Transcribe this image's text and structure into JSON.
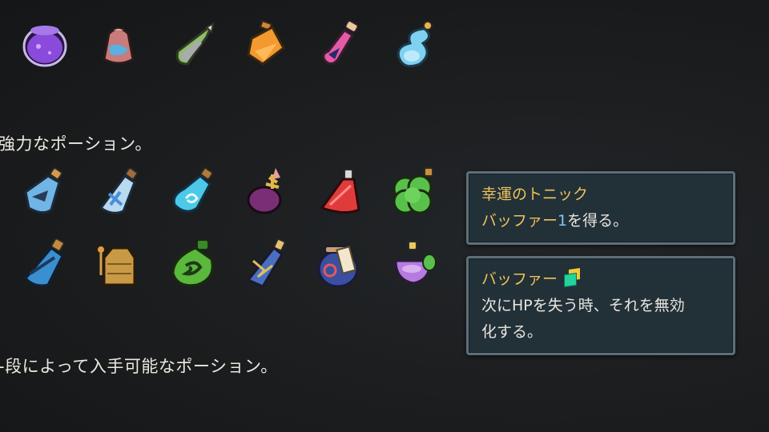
{
  "captions": {
    "partial_top": "強力なポーション。",
    "partial_bottom": "-段によって入手可能なポーション。"
  },
  "potion_rows": [
    {
      "name": "row-1",
      "items": [
        {
          "id": "purple-orb-potion-icon",
          "color": "#8a4bdc"
        },
        {
          "id": "snecko-jar-potion-icon",
          "color": "#c97a7a"
        },
        {
          "id": "green-shard-potion-icon",
          "color": "#8fbf6a"
        },
        {
          "id": "orange-flask-potion-icon",
          "color": "#f29a2e"
        },
        {
          "id": "pink-vial-potion-icon",
          "color": "#e45aa8"
        },
        {
          "id": "blue-gourd-potion-icon",
          "color": "#7fd1f0"
        }
      ]
    },
    {
      "name": "row-2",
      "items": [
        {
          "id": "ship-in-bottle-potion-icon",
          "color": "#6fb6e6"
        },
        {
          "id": "white-x-bottle-potion-icon",
          "color": "#b8d9ef"
        },
        {
          "id": "swirl-bottle-potion-icon",
          "color": "#4cc9e8"
        },
        {
          "id": "purple-cross-potion-icon",
          "color": "#7a2f74"
        },
        {
          "id": "red-flask-potion-icon",
          "color": "#e03b3b"
        },
        {
          "id": "clover-potion-icon",
          "color": "#59c14b"
        }
      ]
    },
    {
      "name": "row-3",
      "items": [
        {
          "id": "blue-chain-bottle-potion-icon",
          "color": "#3a8fd0"
        },
        {
          "id": "golden-pot-potion-icon",
          "color": "#c89a45"
        },
        {
          "id": "green-ghost-jar-potion-icon",
          "color": "#5ab83c"
        },
        {
          "id": "cracked-blue-potion-icon",
          "color": "#4a6fc0"
        },
        {
          "id": "label-jar-potion-icon",
          "color": "#3a4fa0"
        },
        {
          "id": "violet-bowl-potion-icon",
          "color": "#b67be0"
        }
      ]
    }
  ],
  "tooltips": {
    "potion": {
      "title": "幸運のトニック",
      "desc_keyword": "バッファー",
      "desc_number": "1",
      "desc_rest": "を得る。"
    },
    "keyword": {
      "title": "バッファー",
      "icon": "buffer-power-icon",
      "line1": "次にHPを失う時、それを無効",
      "line2": "化する。"
    }
  },
  "colors": {
    "keyword_gold": "#efc25b",
    "number_blue": "#7ec8f2",
    "tooltip_bg": "#223038",
    "tooltip_border": "#5d6f78"
  }
}
